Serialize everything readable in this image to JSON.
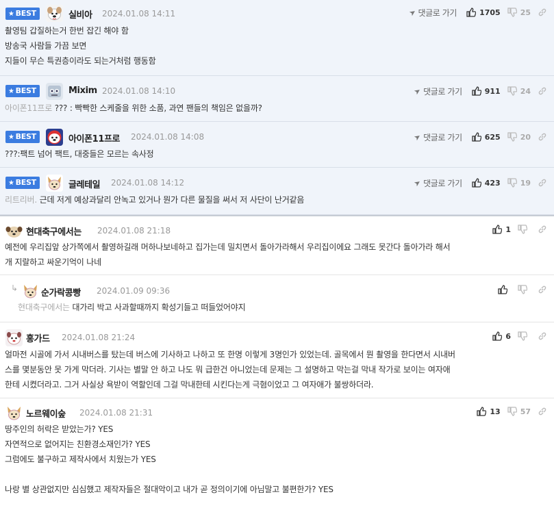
{
  "labels": {
    "best": "BEST",
    "goto": "댓글로 가기"
  },
  "best_comments": [
    {
      "nick": "실비아",
      "date": "2024.01.08 14:11",
      "up": "1705",
      "down": "25",
      "lines": [
        "촬영팀 갑질하는거 한번 잡긴 해야 함",
        "방송국 사람들 가끔 보면",
        "지들이 무슨 특권층이라도 되는거처럼 행동함"
      ]
    },
    {
      "nick": "Mixim",
      "date": "2024.01.08 14:10",
      "up": "911",
      "down": "24",
      "mention": "아이폰11프로",
      "text": " ??? : 빡빡한 스케줄을 위한 소품, 과연 팬들의 책임은 없을까?"
    },
    {
      "nick": "아이폰11프로",
      "date": "2024.01.08 14:08",
      "up": "625",
      "down": "20",
      "text": "???:팩트 넘어 팩트, 대중들은 모르는 속사정"
    },
    {
      "nick": "글레테일",
      "date": "2024.01.08 14:12",
      "up": "423",
      "down": "19",
      "mention": "리트리버.",
      "text": " 근데 저게 예상과달리 안녹고 있거나 뭔가 다른 물질을 써서 저 사단이 난거같음"
    }
  ],
  "comments": [
    {
      "nick": "현대축구에서는",
      "date": "2024.01.08 21:18",
      "up": "1",
      "down": "",
      "lines": [
        "예전에 우리집앞 상가쪽에서 촬영하길래 머하나보네하고 집가는데 밀치면서 돌아가라해서 우리집이에요 그래도 못간다 돌아가라 해서",
        "개 지랄하고 싸운기억이 나네"
      ]
    },
    {
      "nick": "순가락콩빵",
      "date": "2024.01.09 09:36",
      "up": "",
      "down": "",
      "mention": "현대축구에서는",
      "text": " 대가리 박고 사과할때까지 확성기들고 떠들었어야지"
    },
    {
      "nick": "홍가드",
      "date": "2024.01.08 21:24",
      "up": "6",
      "down": "",
      "lines": [
        "얼마전 시골에 가서 시내버스를 탔는데 버스에 기사하고 나하고 또 한명 이렇게 3명인가 있었는데. 골목에서 뭔 촬영을 한다면서 시내버",
        "스를 몇분동안 못 가게 막더라. 기사는 별말 안 하고 나도 뭐 급한건 아니었는데 문제는 그 설명하고 막는걸 막내 작가로 보이는 여자애",
        "한테 시켰더라고. 그거 사실상 욕받이 역할인데 그걸 막내한테 시킨다는게 극혐이었고 그 여자애가 불쌍하더라."
      ]
    },
    {
      "nick": "노르웨이숲",
      "date": "2024.01.08 21:31",
      "up": "13",
      "down": "57",
      "lines": [
        "땅주인의 허락은 받았는가? YES",
        "자연적으로 없어지는 친환경소재인가? YES",
        "그럼에도 불구하고 제작사에서 치웠는가 YES",
        "",
        "나랑 별 상관없지만 심심했고 제작자들은 절대악이고 내가 곧 정의이기에 아님말고 불편한가? YES"
      ]
    }
  ],
  "colors": {
    "best_bg": "#f0f4fa",
    "badge": "#3b7ce0",
    "mention": "#aaaaaa"
  }
}
